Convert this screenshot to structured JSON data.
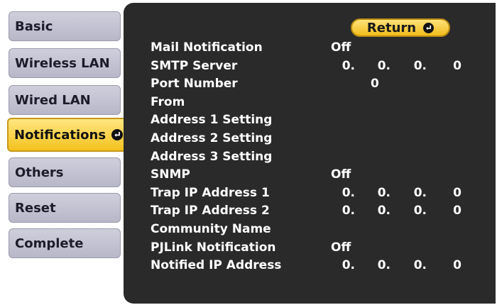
{
  "menu": {
    "items": [
      {
        "label": "Basic"
      },
      {
        "label": "Wireless LAN"
      },
      {
        "label": "Wired LAN"
      },
      {
        "label": "Notifications"
      },
      {
        "label": "Others"
      },
      {
        "label": "Reset"
      },
      {
        "label": "Complete"
      }
    ],
    "selected": "Notifications"
  },
  "panel": {
    "return_label": "Return",
    "rows": {
      "mail_notification": {
        "label": "Mail Notification",
        "value": "Off"
      },
      "smtp_server": {
        "label": "SMTP Server",
        "ip": [
          "0.",
          "0.",
          "0.",
          "0"
        ]
      },
      "port_number": {
        "label": "Port Number",
        "value": "0"
      },
      "from": {
        "label": "From",
        "value": ""
      },
      "address1": {
        "label": "Address 1 Setting",
        "value": ""
      },
      "address2": {
        "label": "Address 2 Setting",
        "value": ""
      },
      "address3": {
        "label": "Address 3 Setting",
        "value": ""
      },
      "snmp": {
        "label": "SNMP",
        "value": "Off"
      },
      "trap1": {
        "label": "Trap IP Address 1",
        "ip": [
          "0.",
          "0.",
          "0.",
          "0"
        ]
      },
      "trap2": {
        "label": "Trap IP Address 2",
        "ip": [
          "0.",
          "0.",
          "0.",
          "0"
        ]
      },
      "community": {
        "label": "Community Name",
        "value": ""
      },
      "pjlink": {
        "label": "PJLink Notification",
        "value": "Off"
      },
      "notified_ip": {
        "label": "Notified IP Address",
        "ip": [
          "0.",
          "0.",
          "0.",
          "0"
        ]
      }
    }
  },
  "colors": {
    "panel_bg": "#2a2a2a",
    "menu_item_bg": "#bdbdcd",
    "selected_bg": "#f4c21e",
    "return_bg": "#f1bd1c"
  },
  "icons": {
    "enter": "enter-return-icon"
  }
}
